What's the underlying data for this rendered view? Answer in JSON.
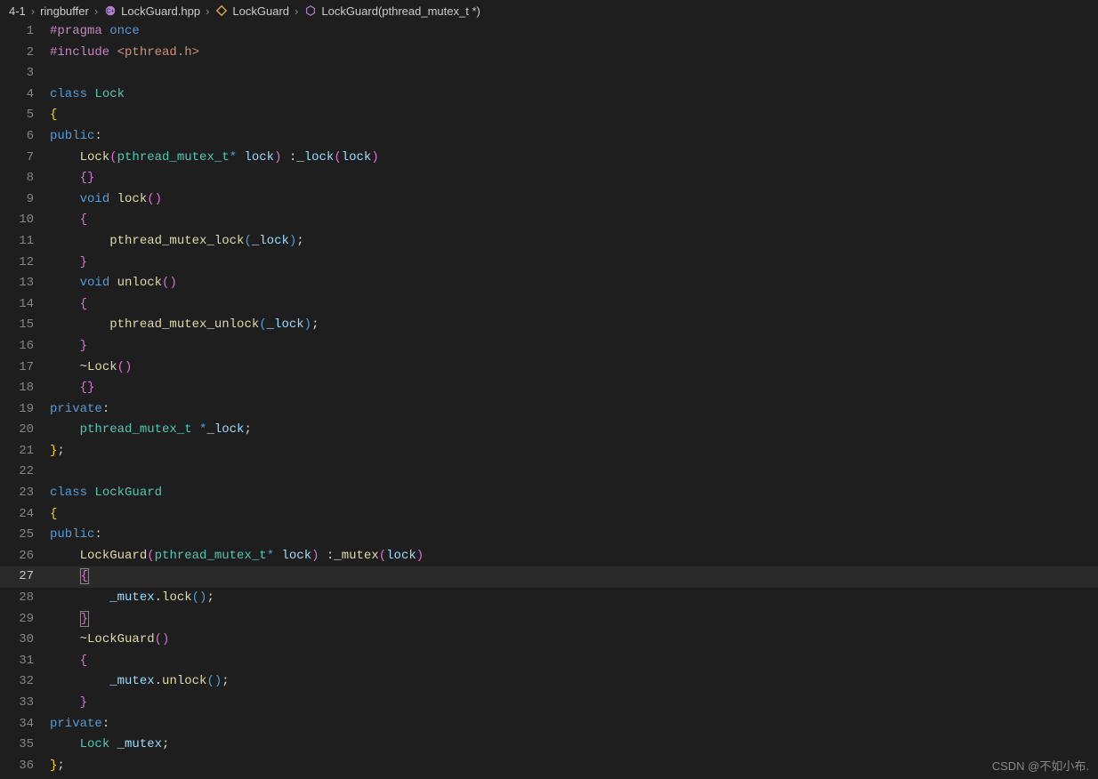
{
  "breadcrumb": {
    "items": [
      {
        "label": "4-1",
        "iconColor": ""
      },
      {
        "label": "ringbuffer",
        "iconColor": ""
      },
      {
        "label": "LockGuard.hpp",
        "iconColor": "#b180d7"
      },
      {
        "label": "LockGuard",
        "iconColor": "#e8ab53"
      },
      {
        "label": "LockGuard(pthread_mutex_t *)",
        "iconColor": "#b180d7"
      }
    ]
  },
  "editor": {
    "currentLine": 27,
    "lines": [
      {
        "n": 1,
        "html": "<span class='kw2'>#pragma</span> <span class='kw'>once</span>"
      },
      {
        "n": 2,
        "html": "<span class='kw2'>#include</span> <span class='str'>&lt;pthread.h&gt;</span>"
      },
      {
        "n": 3,
        "html": ""
      },
      {
        "n": 4,
        "html": "<span class='kw'>class</span> <span class='type'>Lock</span>"
      },
      {
        "n": 5,
        "html": "<span class='brace'>{</span>"
      },
      {
        "n": 6,
        "html": "<span class='kw'>public</span>:"
      },
      {
        "n": 7,
        "html": "    <span class='func'>Lock</span><span class='brace2'>(</span><span class='type'>pthread_mutex_t</span><span class='kw'>*</span> <span class='var'>lock</span><span class='brace2'>)</span> :<span class='var'>_lock</span><span class='brace2'>(</span><span class='var'>lock</span><span class='brace2'>)</span>"
      },
      {
        "n": 8,
        "html": "    <span class='brace2'>{}</span>"
      },
      {
        "n": 9,
        "html": "    <span class='kw'>void</span> <span class='func'>lock</span><span class='brace2'>()</span>"
      },
      {
        "n": 10,
        "html": "    <span class='brace2'>{</span>"
      },
      {
        "n": 11,
        "html": "        <span class='func'>pthread_mutex_lock</span><span class='kw'>(</span><span class='var'>_lock</span><span class='kw'>)</span>;"
      },
      {
        "n": 12,
        "html": "    <span class='brace2'>}</span>"
      },
      {
        "n": 13,
        "html": "    <span class='kw'>void</span> <span class='func'>unlock</span><span class='brace2'>()</span>"
      },
      {
        "n": 14,
        "html": "    <span class='brace2'>{</span>"
      },
      {
        "n": 15,
        "html": "        <span class='func'>pthread_mutex_unlock</span><span class='kw'>(</span><span class='var'>_lock</span><span class='kw'>)</span>;"
      },
      {
        "n": 16,
        "html": "    <span class='brace2'>}</span>"
      },
      {
        "n": 17,
        "html": "    ~<span class='func'>Lock</span><span class='brace2'>()</span>"
      },
      {
        "n": 18,
        "html": "    <span class='brace2'>{}</span>"
      },
      {
        "n": 19,
        "html": "<span class='kw'>private</span>:"
      },
      {
        "n": 20,
        "html": "    <span class='type'>pthread_mutex_t</span> <span class='kw'>*</span><span class='var'>_lock</span>;"
      },
      {
        "n": 21,
        "html": "<span class='brace'>}</span>;"
      },
      {
        "n": 22,
        "html": ""
      },
      {
        "n": 23,
        "html": "<span class='kw'>class</span> <span class='type'>LockGuard</span>"
      },
      {
        "n": 24,
        "html": "<span class='brace'>{</span>"
      },
      {
        "n": 25,
        "html": "<span class='kw'>public</span>:"
      },
      {
        "n": 26,
        "html": "    <span class='func'>LockGuard</span><span class='brace2'>(</span><span class='type'>pthread_mutex_t</span><span class='kw'>*</span> <span class='var'>lock</span><span class='brace2'>)</span> :<span class='func'>_mutex</span><span class='brace2'>(</span><span class='var'>lock</span><span class='brace2'>)</span>"
      },
      {
        "n": 27,
        "html": "    <span class='brace2 sel-brace'>{</span>"
      },
      {
        "n": 28,
        "html": "        <span class='var'>_mutex</span>.<span class='func'>lock</span><span class='kw'>()</span>;"
      },
      {
        "n": 29,
        "html": "    <span class='brace2 sel-brace'>}</span>"
      },
      {
        "n": 30,
        "html": "    ~<span class='func'>LockGuard</span><span class='brace2'>()</span>"
      },
      {
        "n": 31,
        "html": "    <span class='brace2'>{</span>"
      },
      {
        "n": 32,
        "html": "        <span class='var'>_mutex</span>.<span class='func'>unlock</span><span class='kw'>()</span>;"
      },
      {
        "n": 33,
        "html": "    <span class='brace2'>}</span>"
      },
      {
        "n": 34,
        "html": "<span class='kw'>private</span>:"
      },
      {
        "n": 35,
        "html": "    <span class='type'>Lock</span> <span class='var'>_mutex</span>;"
      },
      {
        "n": 36,
        "html": "<span class='brace'>}</span>;"
      }
    ]
  },
  "watermark": "CSDN @不如小布."
}
